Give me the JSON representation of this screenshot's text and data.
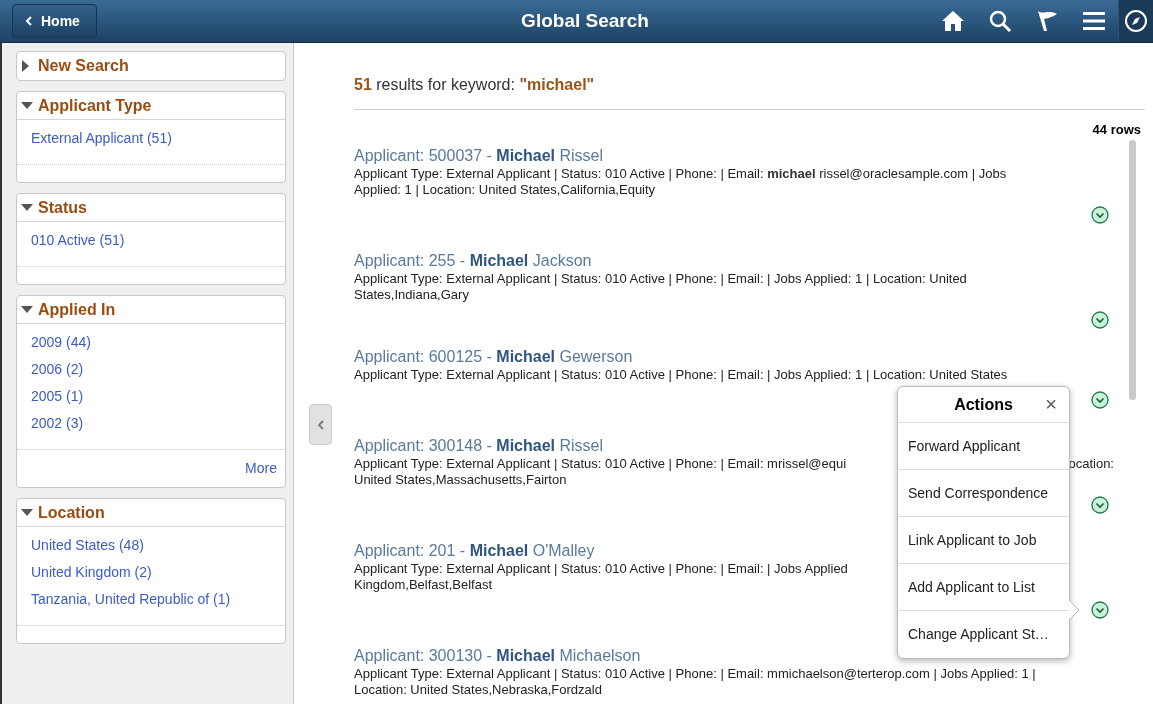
{
  "header": {
    "home_button": "Home",
    "title": "Global Search"
  },
  "sidebar": {
    "panels": [
      {
        "title": "New Search",
        "expanded": false
      },
      {
        "title": "Applicant Type",
        "expanded": true,
        "items": [
          "External Applicant (51)"
        ]
      },
      {
        "title": "Status",
        "expanded": true,
        "items": [
          "010 Active (51)"
        ]
      },
      {
        "title": "Applied In",
        "expanded": true,
        "items": [
          "2009 (44)",
          "2006 (2)",
          "2005 (1)",
          "2002 (3)"
        ],
        "more": "More"
      },
      {
        "title": "Location",
        "expanded": true,
        "items": [
          "United States (48)",
          "United Kingdom (2)",
          "Tanzania, United Republic of (1)"
        ]
      }
    ]
  },
  "results": {
    "summary": "**51** results for keyword: **\"michael\"**",
    "row_count": "44 rows",
    "rows": [
      {
        "title": "Applicant: 500037 - **Michael** Rissel",
        "lines": [
          [
            "Applicant Type: External Applicant | Status: 010 Active | Phone: | Email: **michael** rissel@oraclesample.com | Jobs"
          ],
          [
            "Applied: 1 | Location: United States,California,Equity"
          ]
        ]
      },
      {
        "title": "Applicant: 255 - **Michael** Jackson",
        "lines": [
          [
            "Applicant Type: External Applicant | Status: 010 Active | Phone: | Email: | Jobs Applied: 1 | Location: United"
          ],
          [
            "States,Indiana,Gary"
          ]
        ]
      },
      {
        "title": "Applicant: 600125 - **Michael** Gewerson",
        "lines": [
          [
            "Applicant Type: External Applicant | Status: 010 Active | Phone: | Email: | Jobs Applied: 1 | Location: United States"
          ]
        ]
      },
      {
        "title": "Applicant: 300148 - **Michael** Rissel",
        "lines": [
          [
            "Applicant Type: External Applicant | Status: 010 Active | Phone: | Email: mrissel@equi",
            "ocation:"
          ],
          [
            "United States,Massachusetts,Fairton"
          ]
        ]
      },
      {
        "title": "Applicant: 201 - **Michael** O'Malley",
        "lines": [
          [
            "Applicant Type: External Applicant | Status: 010 Active | Phone: | Email: | Jobs Applied"
          ],
          [
            "Kingdom,Belfast,Belfast"
          ]
        ]
      },
      {
        "title": "Applicant: 300130 - **Michael** Michaelson",
        "lines": [
          [
            "Applicant Type: External Applicant | Status: 010 Active | Phone: | Email: mmichaelson@terterop.com | Jobs Applied: 1 |"
          ],
          [
            "Location: United States,Nebraska,Fordzald"
          ]
        ]
      }
    ]
  },
  "actions_popup": {
    "title": "Actions",
    "close": "×",
    "items": [
      "Forward Applicant",
      "Send Correspondence",
      "Link Applicant to Job",
      "Add Applicant to List",
      "Change Applicant St…"
    ]
  }
}
